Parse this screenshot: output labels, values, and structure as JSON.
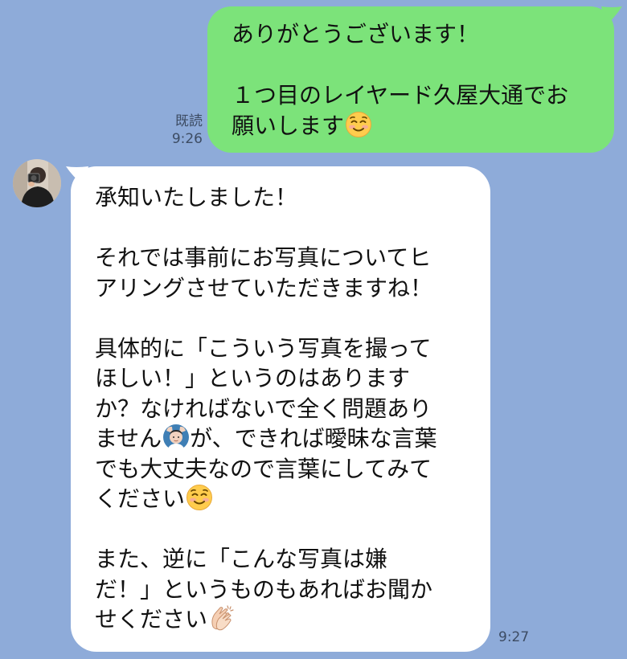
{
  "chat": {
    "outgoing": {
      "lines": [
        "ありがとうございます！",
        "",
        "１つ目のレイヤード久屋大通でお",
        "願いします"
      ],
      "end_emoji": "smiling-face-emoji",
      "read_label": "既読",
      "time": "9:26",
      "bubble_color": "#7ce37a"
    },
    "incoming": {
      "avatar": "avatar-person-with-camera",
      "lines": [
        "承知いたしました！",
        "",
        "それでは事前にお写真についてヒ",
        "アリングさせていただきますね！",
        "",
        "具体的に「こういう写真を撮って",
        "ほしい！」というのはあります",
        "か？なければないで全く問題あり"
      ],
      "line_with_emoji_a": "ません",
      "line_with_emoji_b": "が、できれば曖昧な言葉",
      "line_emoji": "ok-gesture-emoji",
      "lines2": [
        "でも大丈夫なので言葉にしてみて"
      ],
      "line_end_emoji_text": "ください",
      "line_end_emoji": "smiling-face-emoji",
      "lines3": [
        "",
        "また、逆に「こんな写真は嫌",
        "だ！」というものもあればお聞か"
      ],
      "last_line_text": "せください",
      "last_line_emoji": "clapping-hands-emoji",
      "time": "9:27",
      "bubble_color": "#ffffff"
    },
    "background_color": "#8eabd9"
  }
}
